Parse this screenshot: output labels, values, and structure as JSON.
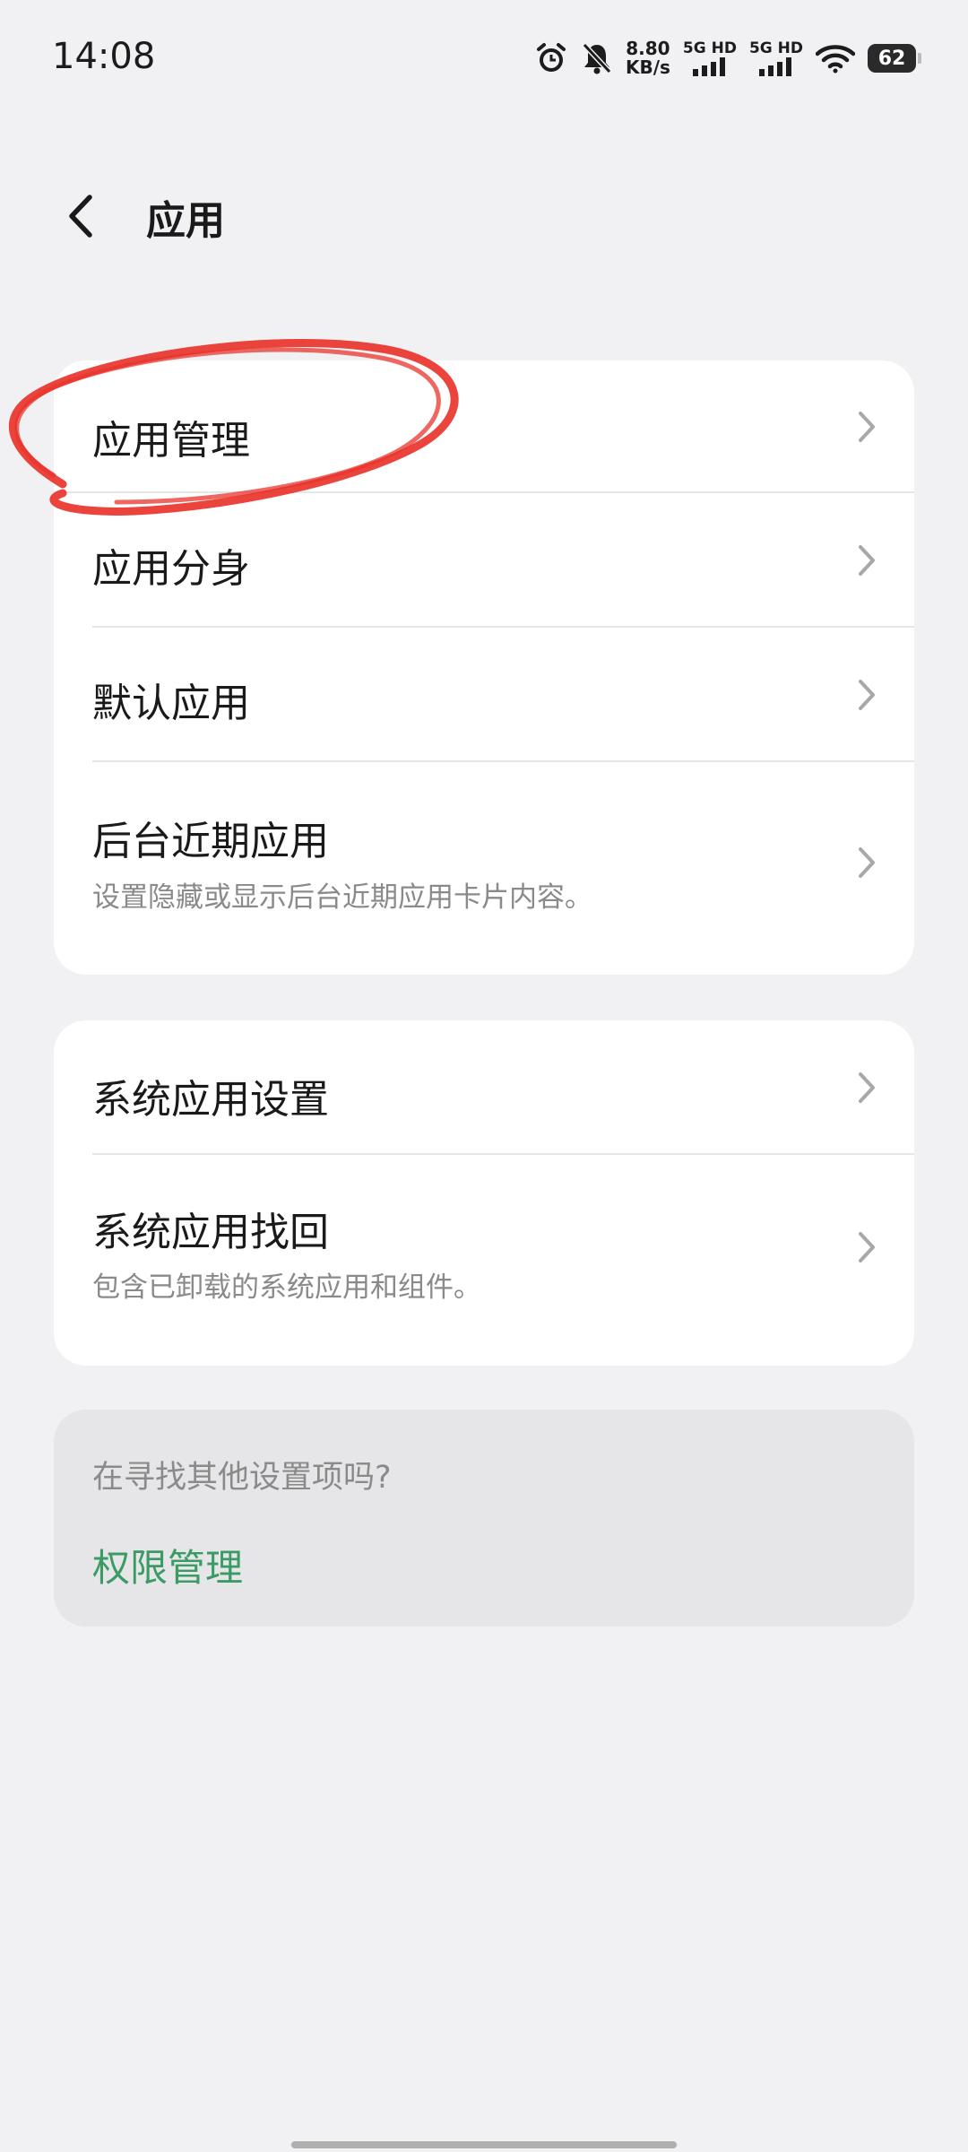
{
  "status_bar": {
    "time": "14:08",
    "net_speed_value": "8.80",
    "net_speed_unit": "KB/s",
    "sim1_label": "5G HD",
    "sim2_label": "5G HD",
    "battery_level": "62"
  },
  "header": {
    "title": "应用"
  },
  "card1": {
    "items": [
      {
        "title": "应用管理"
      },
      {
        "title": "应用分身"
      },
      {
        "title": "默认应用"
      },
      {
        "title": "后台近期应用",
        "subtitle": "设置隐藏或显示后台近期应用卡片内容。"
      }
    ]
  },
  "card2": {
    "items": [
      {
        "title": "系统应用设置"
      },
      {
        "title": "系统应用找回",
        "subtitle": "包含已卸载的系统应用和组件。"
      }
    ]
  },
  "hint": {
    "question": "在寻找其他设置项吗?",
    "link": "权限管理"
  },
  "colors": {
    "background": "#f1f1f3",
    "card": "#ffffff",
    "hint_card": "#e6e6e8",
    "link_green": "#3a9b64",
    "annotation_red": "#e8342c"
  },
  "icons": {
    "back": "chevron-left-icon",
    "row_arrow": "chevron-right-icon",
    "alarm": "alarm-clock-icon",
    "mute": "bell-off-icon",
    "wifi": "wifi-icon",
    "signal": "signal-bars-icon"
  }
}
